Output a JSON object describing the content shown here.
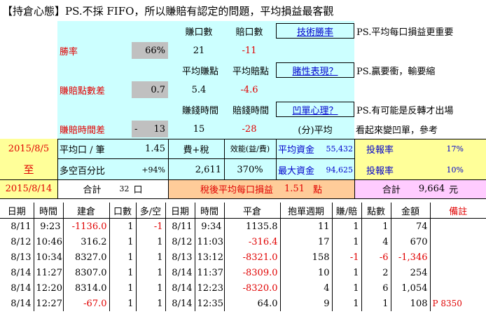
{
  "header": {
    "title": "【持倉心態】PS.不採 FIFO，所以賺賠有認定的問題，平均損益最客觀"
  },
  "stats": {
    "col_win": "賺口數",
    "col_loss": "賠口數",
    "link_skill": "技術勝率",
    "note_skill": "PS.平均每口損益更重要",
    "win_rate_label": "勝率",
    "win_rate_value": "66%",
    "win_count": "21",
    "loss_count": "-11",
    "avg_win_label": "平均賺點",
    "avg_loss_label": "平均賠點",
    "link_gambling": "賭性表現？",
    "note_gambling": "PS.贏要衝，輸要縮",
    "ratio_label": "賺賠點數差",
    "ratio_value": "0.7",
    "avg_win": "5.4",
    "avg_loss": "-4.6",
    "win_time_label": "賺錢時間",
    "loss_time_label": "賠錢時間",
    "link_psych": "凹單心理？",
    "note_psych": "PS.有可能是反轉才出場",
    "time_diff_label": "賺賠時間差",
    "time_diff_sign": "-",
    "time_diff_value": "13",
    "win_time": "15",
    "loss_time": "-28",
    "unit_label": "(分)平均",
    "note_hold": "看起來變凹單，參考"
  },
  "summary": {
    "date_from": "2015/8/5",
    "date_to_mark": "至",
    "date_to": "2015/8/14",
    "avg_per_trade_label": "平均口 / 筆",
    "avg_per_trade": "1.45",
    "fee_tax_label": "費+稅",
    "fee_tax": "2,611",
    "efficiency_label": "效能(益/費)",
    "efficiency": "370%",
    "avg_capital_label": "平均資金",
    "avg_capital": "55,432",
    "roi1_label": "投報率",
    "roi1": "17%",
    "long_short_label": "多空百分比",
    "long_short": "+94%",
    "max_capital_label": "最大資金",
    "max_capital": "94,625",
    "roi2_label": "投報率",
    "roi2": "10%",
    "total_lots_label": "合計",
    "total_lots": "32",
    "total_lots_unit": "口",
    "net_avg_label": "稅後平均每口損益",
    "net_avg": "1.51",
    "net_avg_unit": "點",
    "total_label": "合計",
    "total": "9,664",
    "total_unit": "元"
  },
  "trades": {
    "headers": [
      "日期",
      "時間",
      "建倉",
      "口數",
      "多/空",
      "日期",
      "時間",
      "平倉",
      "抱單週期",
      "賺/賠",
      "點數",
      "金額",
      "備註"
    ],
    "rows": [
      [
        "8/11",
        "9:23",
        "-1136.0",
        "1",
        "-1",
        "8/11",
        "9:34",
        "1135.8",
        "11",
        "1",
        "1",
        "74",
        ""
      ],
      [
        "8/12",
        "10:46",
        "316.2",
        "1",
        "1",
        "8/12",
        "11:03",
        "-316.4",
        "17",
        "1",
        "4",
        "670",
        ""
      ],
      [
        "8/13",
        "10:34",
        "8327.0",
        "1",
        "1",
        "8/13",
        "13:12",
        "-8321.0",
        "158",
        "-1",
        "-6",
        "-1,346",
        ""
      ],
      [
        "8/14",
        "11:27",
        "8307.0",
        "1",
        "1",
        "8/14",
        "11:37",
        "-8309.0",
        "10",
        "1",
        "2",
        "254",
        ""
      ],
      [
        "8/14",
        "12:20",
        "8314.0",
        "1",
        "1",
        "8/14",
        "12:23",
        "-8320.0",
        "4",
        "1",
        "6",
        "1,054",
        ""
      ],
      [
        "8/14",
        "12:27",
        "-67.0",
        "1",
        "1",
        "8/14",
        "12:35",
        "64.0",
        "9",
        "1",
        "1",
        "108",
        "P 8350"
      ]
    ]
  },
  "colors": {
    "cyan": "#ccffff",
    "yellow": "#ffff99",
    "orange": "#ffcc99",
    "grey": "#c0c0c0",
    "pink": "#ffccff",
    "red": "#e00000",
    "blue": "#0000cc"
  }
}
